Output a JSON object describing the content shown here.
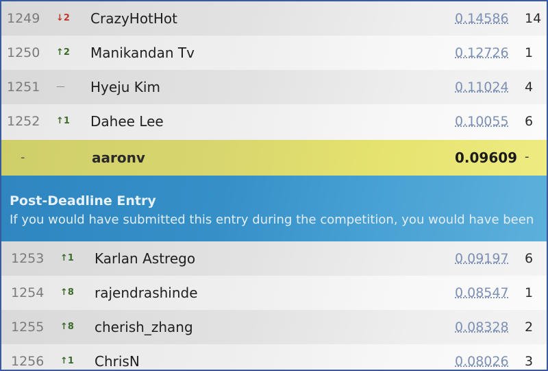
{
  "leaderboard": {
    "rows_top": [
      {
        "rank": "1249",
        "delta": "↓2",
        "direction": "down",
        "team": "CrazyHotHot",
        "score": "0.14586",
        "entries": "14"
      },
      {
        "rank": "1250",
        "delta": "↑2",
        "direction": "up",
        "team": "Manikandan Tv",
        "score": "0.12726",
        "entries": "1"
      },
      {
        "rank": "1251",
        "delta": "—",
        "direction": "none",
        "team": "Hyeju Kim",
        "score": "0.11024",
        "entries": "4"
      },
      {
        "rank": "1252",
        "delta": "↑1",
        "direction": "up",
        "team": "Dahee Lee",
        "score": "0.10055",
        "entries": "6"
      }
    ],
    "highlight": {
      "rank": "-",
      "team": "aaronv",
      "score": "0.09609",
      "entries": "-"
    },
    "banner": {
      "title": "Post-Deadline Entry",
      "text": "If you would have submitted this entry during the competition, you would have been"
    },
    "rows_bottom": [
      {
        "rank": "1253",
        "delta": "↑1",
        "direction": "up",
        "team": "Karlan Astrego",
        "score": "0.09197",
        "entries": "6"
      },
      {
        "rank": "1254",
        "delta": "↑8",
        "direction": "up",
        "team": "rajendrashinde",
        "score": "0.08547",
        "entries": "1"
      },
      {
        "rank": "1255",
        "delta": "↑8",
        "direction": "up",
        "team": "cherish_zhang",
        "score": "0.08328",
        "entries": "2"
      },
      {
        "rank": "1256",
        "delta": "↑1",
        "direction": "up",
        "team": "ChrisN",
        "score": "0.08026",
        "entries": "3"
      }
    ]
  },
  "colors": {
    "highlight": "#d8d66e",
    "banner": "#3590c8",
    "score_link": "#7c8fb4",
    "delta_down": "#c0392b",
    "delta_up": "#3b6b2a"
  }
}
